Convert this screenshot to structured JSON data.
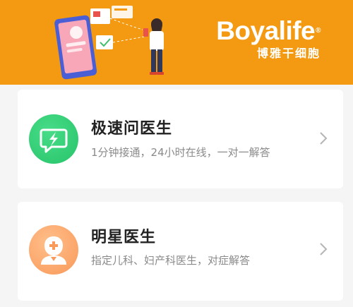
{
  "banner": {
    "brand_name": "Boyalife",
    "brand_reg": "®",
    "brand_subtitle": "博雅干细胞",
    "background_color": "#f49a12"
  },
  "services": [
    {
      "title": "极速问医生",
      "description": "1分钟接通，24小时在线，一对一解答",
      "icon": "chat-lightning-icon",
      "icon_color": "#2fca73"
    },
    {
      "title": "明星医生",
      "description": "指定儿科、妇产科医生，对症解答",
      "icon": "doctor-icon",
      "icon_color": "#fba66a"
    }
  ]
}
